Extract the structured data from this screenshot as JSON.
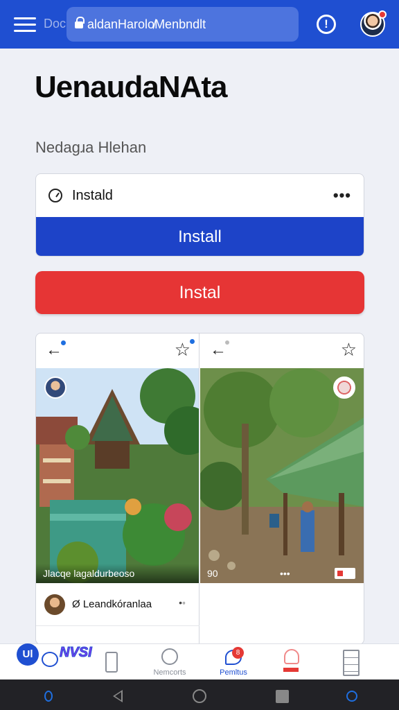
{
  "header": {
    "prefix": "Doc",
    "url": "aldanHarolo̸Menbndlt",
    "colors": {
      "bar": "#1f4fd1",
      "url_bg": "#4d74de"
    }
  },
  "page": {
    "title": "UenaudaNAta",
    "subtitle": "Nedagɹa Hlehan"
  },
  "card": {
    "head_label": "Instald",
    "more": "•••",
    "primary_button": "Install",
    "secondary_button": "Instal"
  },
  "panels": {
    "left": {
      "caption": "Jlacqe lagaldurbeoso",
      "row_label": "Leandkóranlaa",
      "row_prefix": "Ø",
      "row_more": "•◦"
    },
    "right": {
      "caption": "90",
      "caption_mid": "•••"
    }
  },
  "bottom_nav": {
    "badge": "Ul",
    "sticker": "NVSI",
    "items": [
      {
        "label": "Nemcorts",
        "icon": "search-icon",
        "active": false
      },
      {
        "label": "Pemltus",
        "icon": "chat-icon",
        "active": true,
        "count": "8"
      },
      {
        "label": "",
        "icon": "bell-icon",
        "active": false
      },
      {
        "label": "",
        "icon": "document-icon",
        "active": false
      }
    ]
  }
}
